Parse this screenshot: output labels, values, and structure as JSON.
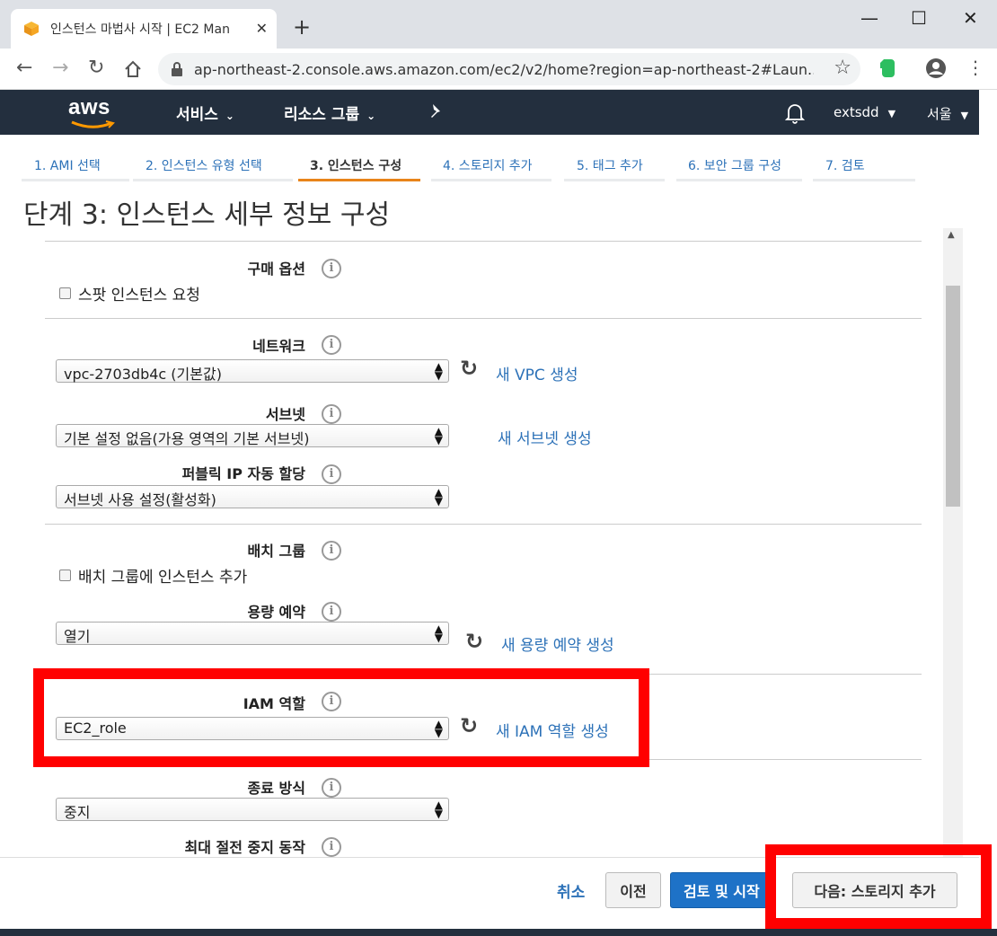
{
  "browser": {
    "tab_title": "인스턴스 마법사 시작 | EC2 Man",
    "url": "ap-northeast-2.console.aws.amazon.com/ec2/v2/home?region=ap-northeast-2#Laun..."
  },
  "aws_header": {
    "logo": "aws",
    "services": "서비스",
    "resource_groups": "리소스 그룹",
    "user": "extsdd",
    "region": "서울"
  },
  "wizard_steps": [
    "1. AMI 선택",
    "2. 인스턴스 유형 선택",
    "3. 인스턴스 구성",
    "4. 스토리지 추가",
    "5. 태그 추가",
    "6. 보안 그룹 구성",
    "7. 검토"
  ],
  "active_step_index": 2,
  "page_title": "단계 3: 인스턴스 세부 정보 구성",
  "form": {
    "purchase_option": {
      "label": "구매 옵션",
      "checkbox": "스팟 인스턴스 요청"
    },
    "network": {
      "label": "네트워크",
      "value": "vpc-2703db4c (기본값)",
      "link": "새 VPC 생성"
    },
    "subnet": {
      "label": "서브넷",
      "value": "기본 설정 없음(가용 영역의 기본 서브넷)",
      "link": "새 서브넷 생성"
    },
    "public_ip": {
      "label": "퍼블릭 IP 자동 할당",
      "value": "서브넷 사용 설정(활성화)"
    },
    "placement_group": {
      "label": "배치 그룹",
      "checkbox": "배치 그룹에 인스턴스 추가"
    },
    "capacity_reservation": {
      "label": "용량 예약",
      "value": "열기",
      "link": "새 용량 예약 생성"
    },
    "iam_role": {
      "label": "IAM 역할",
      "value": "EC2_role",
      "link": "새 IAM 역할 생성"
    },
    "shutdown_behavior": {
      "label": "종료 방식",
      "value": "중지"
    },
    "stop_hibernate": {
      "label": "최대 절전 중지 동작"
    }
  },
  "footer": {
    "cancel": "취소",
    "previous": "이전",
    "review_launch": "검토 및 시작",
    "next": "다음: 스토리지 추가"
  },
  "colors": {
    "aws_navy": "#232f3e",
    "link_blue": "#2d72b8",
    "active_tab_orange": "#e8841a",
    "primary_button": "#1e72c7",
    "highlight_red": "#ff0000"
  }
}
